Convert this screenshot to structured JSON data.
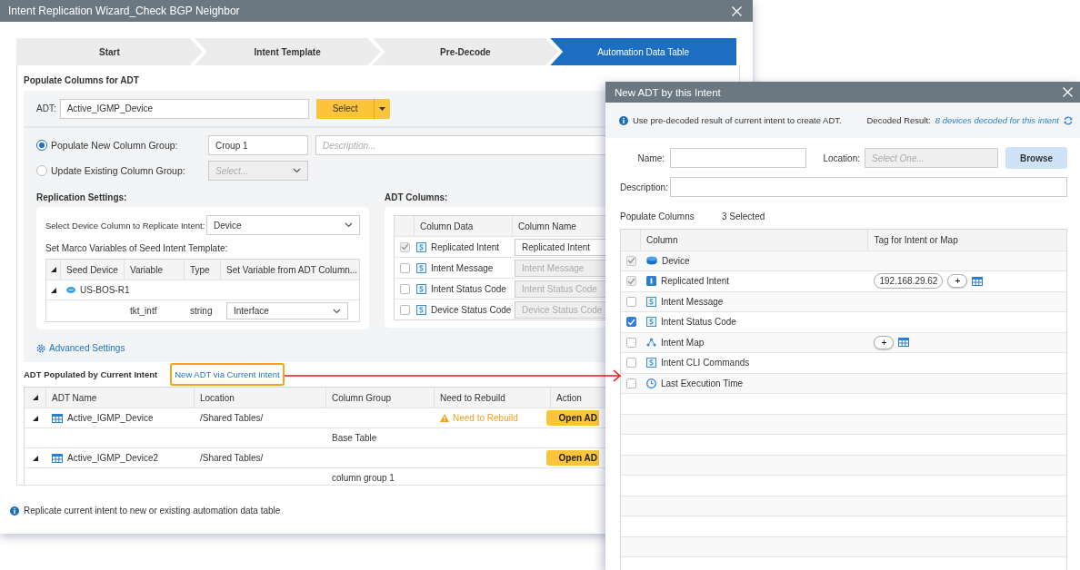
{
  "window": {
    "title": "Intent Replication Wizard_Check BGP Neighbor"
  },
  "steps": [
    {
      "label": "Start",
      "selected": false
    },
    {
      "label": "Intent Template",
      "selected": false
    },
    {
      "label": "Pre-Decode",
      "selected": false
    },
    {
      "label": "Automation Data Table",
      "selected": true
    }
  ],
  "populate": {
    "heading": "Populate Columns for ADT",
    "adt_label": "ADT:",
    "adt_value": "Active_IGMP_Device",
    "select_button": "Select",
    "column_group_options": [
      {
        "kind": "text",
        "label": "Populate New Column Group:",
        "selected": true,
        "value": "Croup 1"
      },
      {
        "kind": "dropdown",
        "label": "Update Existing Column Group:",
        "selected": false,
        "placeholder": "Select..."
      }
    ],
    "description_placeholder": "Description...",
    "replication": {
      "heading": "Replication Settings:",
      "device_column_label": "Select Device Column to Replicate Intent:",
      "device_column_value": "Device",
      "macro_label": "Set Marco Variables of Seed Intent Template:",
      "columns": [
        "Seed Device",
        "Variable",
        "Type",
        "Set Variable from ADT Column..."
      ],
      "devices": [
        {
          "name": "US-BOS-R1",
          "expanded": true,
          "variables": [
            {
              "name": "tkt_intf",
              "type": "string",
              "value": "Interface"
            }
          ]
        }
      ]
    },
    "adt_columns": {
      "heading": "ADT Columns:",
      "columns": [
        "Column Data",
        "Column Name"
      ],
      "rows": [
        {
          "label": "Replicated Intent",
          "checked": true,
          "disabled": true,
          "value": "Replicated Intent"
        },
        {
          "label": "Intent Message",
          "checked": false,
          "placeholder": "Intent Message"
        },
        {
          "label": "Intent Status Code",
          "checked": false,
          "placeholder": "Intent Status Code"
        },
        {
          "label": "Device Status Code",
          "checked": false,
          "placeholder": "Device Status Code"
        }
      ]
    },
    "advanced_settings": "Advanced Settings"
  },
  "populated": {
    "heading": "ADT Populated by Current Intent",
    "link": "New ADT via Current Intent",
    "columns": [
      "ADT Name",
      "Location",
      "Column Group",
      "Need to Rebuild",
      "Action"
    ],
    "rows": [
      {
        "name": "Active_IGMP_Device",
        "location": "/Shared Tables/",
        "expanded": true,
        "rebuild": "Need to Rebuild",
        "action": "Open AD",
        "groups": [
          "Base Table"
        ]
      },
      {
        "name": "Active_IGMP_Device2",
        "location": "/Shared Tables/",
        "expanded": true,
        "action": "Open AD",
        "groups": [
          "column group 1"
        ]
      }
    ]
  },
  "footer_note": "Replicate current intent to new or existing automation data table",
  "dialog": {
    "title": "New ADT by this Intent",
    "info": "Use pre-decoded result of current intent to create ADT.",
    "decoded_label": "Decoded Result:",
    "decoded_link": "8 devices decoded for this intent",
    "name_label": "Name:",
    "location_label": "Location:",
    "location_placeholder": "Select One...",
    "browse_button": "Browse",
    "description_label": "Description:",
    "populate_label": "Populate Columns",
    "selected_count": "3 Selected",
    "columns": [
      "Column",
      "Tag for Intent or Map"
    ],
    "rows": [
      {
        "kind": "device",
        "label": "Device",
        "checked": true,
        "disabled": true
      },
      {
        "kind": "integer",
        "label": "Replicated Intent",
        "checked": true,
        "disabled": true,
        "tags": [
          "192.168.29.62"
        ],
        "add": "+"
      },
      {
        "kind": "string",
        "label": "Intent Message",
        "checked": false
      },
      {
        "kind": "string",
        "label": "Intent Status Code",
        "checked": true
      },
      {
        "kind": "map",
        "label": "Intent Map",
        "checked": false,
        "add": "+"
      },
      {
        "kind": "string",
        "label": "Intent CLI Commands",
        "checked": false
      },
      {
        "kind": "time",
        "label": "Last Execution Time",
        "checked": false
      }
    ]
  }
}
